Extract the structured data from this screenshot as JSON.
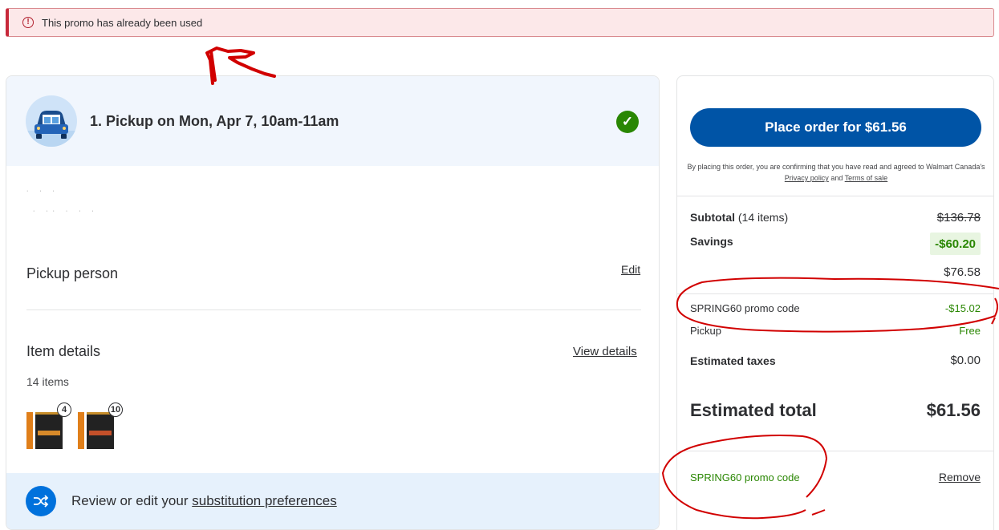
{
  "alert": {
    "icon": "error-icon",
    "message": "This promo has already been used",
    "icon_glyph": "!"
  },
  "pickup": {
    "title": "1. Pickup on Mon, Apr 7, 10am-11am",
    "car_icon": "car-icon",
    "status_icon": "checkmark-icon",
    "status_glyph": "✓"
  },
  "pickup_person": {
    "label": "Pickup person",
    "edit_label": "Edit"
  },
  "item_details": {
    "label": "Item details",
    "view_details_label": "View details",
    "count_text": "14 items",
    "products": [
      {
        "quantity": "4",
        "band_color": "#d88a2a"
      },
      {
        "quantity": "10",
        "band_color": "#c4502a"
      }
    ]
  },
  "substitution": {
    "prefix": "Review or edit your ",
    "link": "substitution preferences",
    "icon": "shuffle-icon"
  },
  "summary": {
    "place_order_label": "Place order for $61.56",
    "terms_prefix": "By placing this order, you are confirming that you have read and agreed to Walmart Canada's ",
    "terms_privacy": "Privacy policy",
    "terms_and": " and ",
    "terms_sale": "Terms of sale",
    "subtotal_label": "Subtotal",
    "subtotal_count": " (14 items)",
    "subtotal_value": "$136.78",
    "savings_label": "Savings",
    "savings_value": "-$60.20",
    "after_savings_value": "$76.58",
    "promo_label": "SPRING60 promo code",
    "promo_value": "-$15.02",
    "pickup_label": "Pickup",
    "pickup_value": "Free",
    "taxes_label": "Estimated taxes",
    "taxes_value": "$0.00",
    "total_label": "Estimated total",
    "total_value": "$61.56",
    "applied_promo_label": "SPRING60 promo code",
    "remove_label": "Remove"
  },
  "colors": {
    "accent_blue": "#0054a6",
    "success_green": "#2a8703",
    "error_red": "#c7283a",
    "annotation_red": "#d10000"
  }
}
